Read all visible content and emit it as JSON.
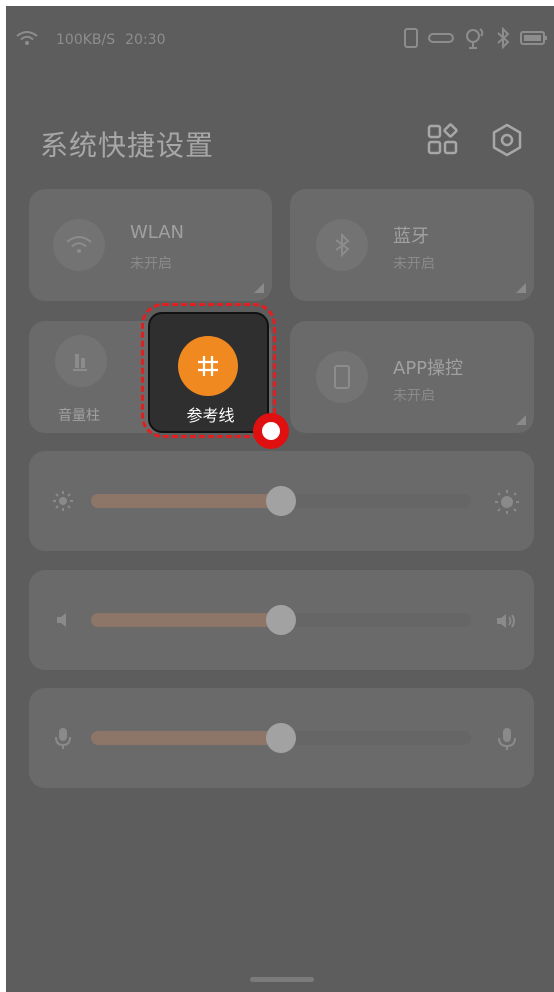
{
  "status_bar": {
    "speed": "100KB/S",
    "time": "20:30",
    "icons": [
      "wifi-icon",
      "phone-icon",
      "link-icon",
      "gyro-icon",
      "bluetooth-icon",
      "battery-icon"
    ]
  },
  "header": {
    "title": "系统快捷设置",
    "icons": [
      "layout-grid-icon",
      "settings-gear-icon"
    ]
  },
  "tiles": [
    {
      "name": "WLAN",
      "status": "未开启",
      "icon": "wifi-icon"
    },
    {
      "name": "蓝牙",
      "status": "未开启",
      "icon": "bluetooth-icon"
    },
    {
      "name": "音量柱",
      "icon": "volume-bar-icon"
    },
    {
      "name": "APP操控",
      "status": "未开启",
      "icon": "phone-icon"
    }
  ],
  "dragging_tile": {
    "name": "参考线",
    "icon": "grid-hash-icon",
    "accent": "#f08a20"
  },
  "sliders": [
    {
      "name": "brightness",
      "icon_left": "sun-small-icon",
      "icon_right": "sun-large-icon",
      "level": 0.5
    },
    {
      "name": "volume",
      "icon_left": "speaker-low-icon",
      "icon_right": "speaker-high-icon",
      "level": 0.5
    },
    {
      "name": "microphone",
      "icon_left": "mic-icon",
      "icon_right": "mic-icon",
      "level": 0.5
    }
  ],
  "colors": {
    "accent": "#f08a20",
    "drag_highlight": "#e02020",
    "slider_fill": "#8d7568"
  }
}
